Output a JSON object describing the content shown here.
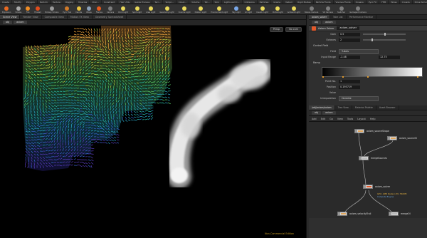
{
  "shelf_tabs": [
    "Create",
    "Modify",
    "Polygon",
    "Deform",
    "Texture",
    "Rigging",
    "Muscles",
    "Char...",
    "Constraint",
    "Hair Utils",
    "Guide Process",
    "Terr...",
    "Simpl...",
    "Cloud...",
    "Volume",
    "Tet...",
    "Skin",
    "Lights and C...",
    "Collisions",
    "Particles",
    "Grains",
    "Vellum",
    "Rigid Bodies",
    "Particle Fluids",
    "Viscous Fluids",
    "Oceans",
    "Pyro FX",
    "FEM",
    "Wires",
    "Crowds",
    "Drive Simulation"
  ],
  "tools": [
    {
      "label": "Explosion",
      "icon": "explosion-icon",
      "color": "#e86a22"
    },
    {
      "label": "Smoke",
      "icon": "smoke-icon",
      "color": "#aaaaaa"
    },
    {
      "label": "Fire",
      "icon": "fire-icon",
      "color": "#ef8c26"
    },
    {
      "label": "Fireball",
      "icon": "fireball-icon",
      "color": "#e04d1c"
    },
    {
      "label": "Billowy Smoke",
      "icon": "billowy-smoke-icon",
      "color": "#9a9a9a"
    },
    {
      "label": "Pyro Trail",
      "icon": "pyro-trail-icon",
      "color": "#d07a2a"
    },
    {
      "label": "Candle",
      "icon": "candle-icon",
      "color": "#e8c240"
    },
    {
      "label": "Wisps",
      "icon": "wisps-icon",
      "color": "#8aa0b8"
    },
    {
      "label": "Flames",
      "icon": "flames-icon",
      "color": "#e65a1e"
    },
    {
      "label": "Camera",
      "icon": "camera-icon",
      "color": "#7c7c7c"
    },
    {
      "label": "Point Light",
      "icon": "point-light-icon",
      "color": "#e8d85a"
    },
    {
      "label": "Spot Light",
      "icon": "spot-light-icon",
      "color": "#e8d85a"
    },
    {
      "label": "Area Light",
      "icon": "area-light-icon",
      "color": "#e8d85a"
    },
    {
      "label": "Geometry Light",
      "icon": "geometry-light-icon",
      "color": "#e8d85a"
    },
    {
      "label": "Volume Light",
      "icon": "volume-light-icon",
      "color": "#e8d85a"
    },
    {
      "label": "Distant Light",
      "icon": "distant-light-icon",
      "color": "#e8d85a"
    },
    {
      "label": "Environment Light",
      "icon": "environment-light-icon",
      "color": "#e8d85a"
    },
    {
      "label": "Sky Light",
      "icon": "sky-light-icon",
      "color": "#7aa8e8"
    },
    {
      "label": "GI Light",
      "icon": "gi-light-icon",
      "color": "#e8d85a"
    },
    {
      "label": "Caustic Light",
      "icon": "caustic-light-icon",
      "color": "#e8d85a"
    },
    {
      "label": "Portal Light",
      "icon": "portal-light-icon",
      "color": "#e8d85a"
    },
    {
      "label": "Ambient Light",
      "icon": "ambient-light-icon",
      "color": "#e8d85a"
    },
    {
      "label": "Stereo Camera",
      "icon": "stereo-camera-icon",
      "color": "#7c7c7c"
    },
    {
      "label": "VR Camera",
      "icon": "vr-camera-icon",
      "color": "#7c7c7c"
    },
    {
      "label": "Switcher",
      "icon": "switcher-icon",
      "color": "#7c7c7c"
    },
    {
      "label": "Gamepad Camera",
      "icon": "gamepad-camera-icon",
      "color": "#7c7c7c"
    }
  ],
  "viewport": {
    "tabs": [
      "Scene View",
      "Render View",
      "Composite View",
      "Motion FX View",
      "Geometry Spreadsheet"
    ],
    "path_obj": "obj",
    "path_node": "axiom",
    "buttons": [
      "Persp",
      "No cam"
    ],
    "non_commercial": "Non-Commercial Edition"
  },
  "params": {
    "tabs": [
      "axiom_solver",
      "Take List",
      "Performance Monitor"
    ],
    "path_obj": "obj",
    "path_node": "axiom",
    "node_type": "Axiom Solver",
    "node_name": "axiom_solver",
    "rows": [
      {
        "label": "Gain",
        "value": "0.5",
        "knob": 0.5
      },
      {
        "label": "Octaves",
        "value": "2",
        "knob": 0.2
      }
    ],
    "control_field_title": "Control Field",
    "field_label": "Field",
    "field_value": "Y-Axis",
    "input_range_label": "Input Range",
    "input_range_min": "-2.48",
    "input_range_max": "12.75",
    "ramp_label": "Ramp",
    "ramp_knots": [
      0.0,
      0.2,
      0.45,
      0.95
    ],
    "point_no_label": "Point No.",
    "point_no_value": "1",
    "position_label": "Position",
    "position_value": "0.195719",
    "value_label": "Value",
    "interp_label": "Interpolation",
    "interp_value": "Hermite"
  },
  "network": {
    "tabs": [
      "/obj/axiom/axiom",
      "Tree View",
      "Material Palette",
      "Asset Browser"
    ],
    "path_obj": "obj",
    "path_node": "axiom",
    "menu": [
      "Add",
      "Edit",
      "Go",
      "View",
      "Tools",
      "Layout",
      "Help"
    ],
    "nodes": [
      {
        "name": "axiom_sourceShape"
      },
      {
        "name": "axiom_sourceSl"
      },
      {
        "name": "mergeSources"
      },
      {
        "name": "axiom_solver"
      },
      {
        "name": "axiom_velocityTrail"
      },
      {
        "name": "mergeOl"
      }
    ],
    "gpu_line": "GPU: AMD Radeon Pro 5600M",
    "engine_line": "Compute Engine"
  }
}
